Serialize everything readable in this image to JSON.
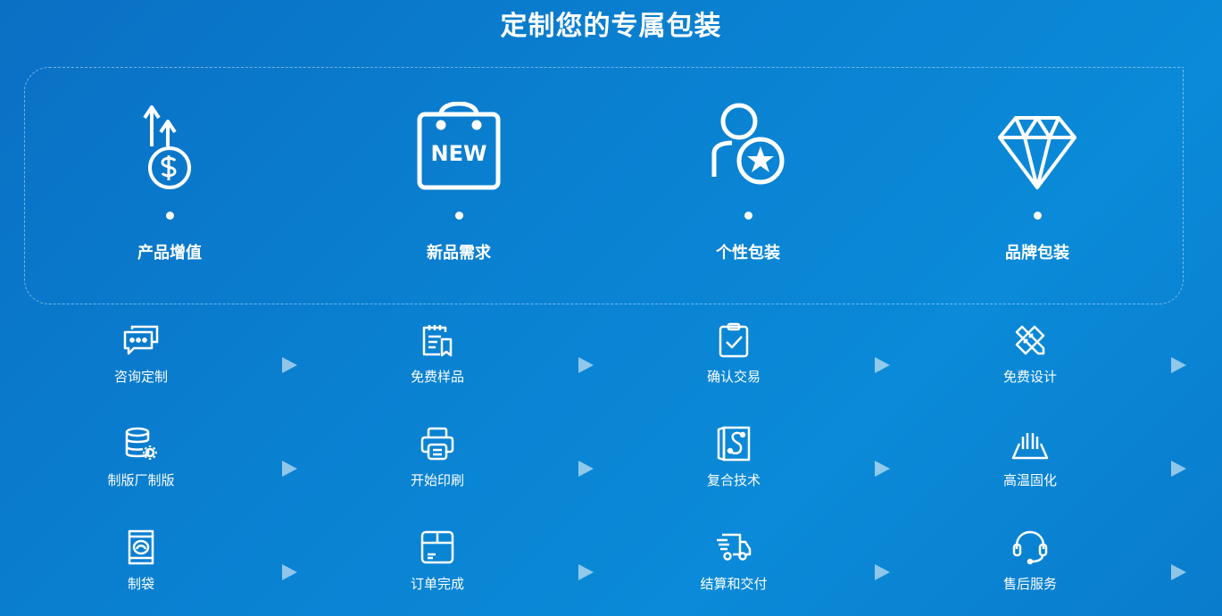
{
  "title": "定制您的专属包装",
  "features": [
    {
      "label": "产品增值",
      "icon": "dollar-growth-icon"
    },
    {
      "label": "新品需求",
      "icon": "new-bag-icon"
    },
    {
      "label": "个性包装",
      "icon": "user-star-icon"
    },
    {
      "label": "品牌包装",
      "icon": "diamond-icon"
    }
  ],
  "steps": [
    {
      "label": "咨询定制",
      "icon": "chat-icon"
    },
    {
      "label": "免费样品",
      "icon": "sample-doc-icon"
    },
    {
      "label": "确认交易",
      "icon": "clipboard-check-icon"
    },
    {
      "label": "免费设计",
      "icon": "design-tools-icon"
    },
    {
      "label": "制版厂制版",
      "icon": "database-gear-icon"
    },
    {
      "label": "开始印刷",
      "icon": "printer-icon"
    },
    {
      "label": "复合技术",
      "icon": "compound-roll-icon"
    },
    {
      "label": "高温固化",
      "icon": "heat-curing-icon"
    },
    {
      "label": "制袋",
      "icon": "bag-icon"
    },
    {
      "label": "订单完成",
      "icon": "box-icon"
    },
    {
      "label": "结算和交付",
      "icon": "delivery-truck-icon"
    },
    {
      "label": "售后服务",
      "icon": "headset-icon"
    }
  ]
}
